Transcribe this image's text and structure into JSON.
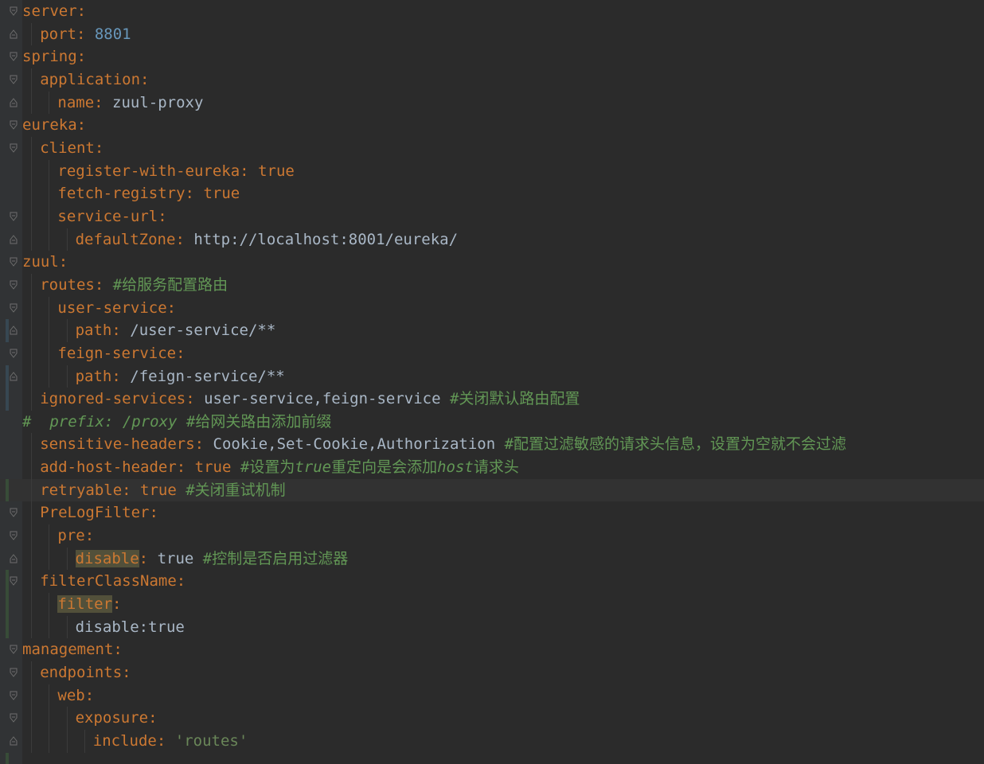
{
  "lines": [
    {
      "indent": 0,
      "fold": "open",
      "tokens": [
        {
          "t": "server",
          "c": "key"
        },
        {
          "t": ":",
          "c": "punc"
        }
      ]
    },
    {
      "indent": 1,
      "fold": "close",
      "tokens": [
        {
          "t": "port",
          "c": "key"
        },
        {
          "t": ": ",
          "c": "punc"
        },
        {
          "t": "8801",
          "c": "num"
        }
      ]
    },
    {
      "indent": 0,
      "fold": "open",
      "tokens": [
        {
          "t": "spring",
          "c": "key"
        },
        {
          "t": ":",
          "c": "punc"
        }
      ]
    },
    {
      "indent": 1,
      "fold": "open",
      "tokens": [
        {
          "t": "application",
          "c": "key"
        },
        {
          "t": ":",
          "c": "punc"
        }
      ]
    },
    {
      "indent": 2,
      "fold": "close",
      "tokens": [
        {
          "t": "name",
          "c": "key"
        },
        {
          "t": ": ",
          "c": "punc"
        },
        {
          "t": "zuul-proxy",
          "c": "val"
        }
      ]
    },
    {
      "indent": 0,
      "fold": "open",
      "tokens": [
        {
          "t": "eureka",
          "c": "key"
        },
        {
          "t": ":",
          "c": "punc"
        }
      ]
    },
    {
      "indent": 1,
      "fold": "open",
      "tokens": [
        {
          "t": "client",
          "c": "key"
        },
        {
          "t": ":",
          "c": "punc"
        }
      ]
    },
    {
      "indent": 2,
      "fold": "",
      "tokens": [
        {
          "t": "register-with-eureka",
          "c": "key"
        },
        {
          "t": ": ",
          "c": "punc"
        },
        {
          "t": "true",
          "c": "key"
        }
      ]
    },
    {
      "indent": 2,
      "fold": "",
      "tokens": [
        {
          "t": "fetch-registry",
          "c": "key"
        },
        {
          "t": ": ",
          "c": "punc"
        },
        {
          "t": "true",
          "c": "key"
        }
      ]
    },
    {
      "indent": 2,
      "fold": "open",
      "tokens": [
        {
          "t": "service-url",
          "c": "key"
        },
        {
          "t": ":",
          "c": "punc"
        }
      ]
    },
    {
      "indent": 3,
      "fold": "close",
      "tokens": [
        {
          "t": "defaultZone",
          "c": "key"
        },
        {
          "t": ": ",
          "c": "punc"
        },
        {
          "t": "http://localhost:8001/eureka/",
          "c": "val"
        }
      ]
    },
    {
      "indent": 0,
      "fold": "open",
      "tokens": [
        {
          "t": "zuul",
          "c": "key"
        },
        {
          "t": ":",
          "c": "punc"
        }
      ]
    },
    {
      "indent": 1,
      "fold": "open",
      "tokens": [
        {
          "t": "routes",
          "c": "key"
        },
        {
          "t": ": ",
          "c": "punc"
        },
        {
          "t": "#给服务配置路由",
          "c": "cmt"
        }
      ]
    },
    {
      "indent": 2,
      "fold": "open",
      "tokens": [
        {
          "t": "user-service",
          "c": "key"
        },
        {
          "t": ":",
          "c": "punc"
        }
      ]
    },
    {
      "indent": 3,
      "fold": "close",
      "change": "mod",
      "tokens": [
        {
          "t": "path",
          "c": "key"
        },
        {
          "t": ": ",
          "c": "punc"
        },
        {
          "t": "/user-service/**",
          "c": "val"
        }
      ]
    },
    {
      "indent": 2,
      "fold": "open",
      "tokens": [
        {
          "t": "feign-service",
          "c": "key"
        },
        {
          "t": ":",
          "c": "punc"
        }
      ]
    },
    {
      "indent": 3,
      "fold": "close",
      "change": "mod",
      "tokens": [
        {
          "t": "path",
          "c": "key"
        },
        {
          "t": ": ",
          "c": "punc"
        },
        {
          "t": "/feign-service/**",
          "c": "val"
        }
      ]
    },
    {
      "indent": 1,
      "fold": "",
      "change": "mod",
      "tokens": [
        {
          "t": "ignored-services",
          "c": "key"
        },
        {
          "t": ": ",
          "c": "punc"
        },
        {
          "t": "user-service,feign-service ",
          "c": "val"
        },
        {
          "t": "#关闭默认路由配置",
          "c": "cmt"
        }
      ]
    },
    {
      "indent": 0,
      "fold": "",
      "tokens": [
        {
          "t": "#  prefix: /proxy ",
          "c": "cmt cmt-it"
        },
        {
          "t": "#给网关路由添加前缀",
          "c": "cmt"
        }
      ]
    },
    {
      "indent": 1,
      "fold": "",
      "tokens": [
        {
          "t": "sensitive-headers",
          "c": "key"
        },
        {
          "t": ": ",
          "c": "punc"
        },
        {
          "t": "Cookie,Set-Cookie,Authorization ",
          "c": "val"
        },
        {
          "t": "#配置过滤敏感的请求头信息，设置为空就不会过滤",
          "c": "cmt"
        }
      ]
    },
    {
      "indent": 1,
      "fold": "",
      "tokens": [
        {
          "t": "add-host-header",
          "c": "key"
        },
        {
          "t": ": ",
          "c": "punc"
        },
        {
          "t": "true ",
          "c": "key"
        },
        {
          "t": "#设置为",
          "c": "cmt"
        },
        {
          "t": "true",
          "c": "cmt cmt-it"
        },
        {
          "t": "重定向是会添加",
          "c": "cmt"
        },
        {
          "t": "host",
          "c": "cmt cmt-it"
        },
        {
          "t": "请求头",
          "c": "cmt"
        }
      ]
    },
    {
      "indent": 1,
      "fold": "",
      "change": "add",
      "current": true,
      "tokens": [
        {
          "t": "retryable",
          "c": "key"
        },
        {
          "t": ": ",
          "c": "punc"
        },
        {
          "t": "true ",
          "c": "key"
        },
        {
          "t": "#关闭重试机制",
          "c": "cmt"
        }
      ]
    },
    {
      "indent": 1,
      "fold": "open",
      "tokens": [
        {
          "t": "PreLogFilter",
          "c": "key"
        },
        {
          "t": ":",
          "c": "punc"
        }
      ]
    },
    {
      "indent": 2,
      "fold": "open",
      "tokens": [
        {
          "t": "pre",
          "c": "key"
        },
        {
          "t": ":",
          "c": "punc"
        }
      ]
    },
    {
      "indent": 3,
      "fold": "close",
      "tokens": [
        {
          "t": "disable",
          "c": "key hl"
        },
        {
          "t": ": ",
          "c": "punc"
        },
        {
          "t": "true ",
          "c": "val"
        },
        {
          "t": "#控制是否启用过滤器",
          "c": "cmt"
        }
      ]
    },
    {
      "indent": 1,
      "fold": "open",
      "change": "add",
      "tokens": [
        {
          "t": "filterClassName",
          "c": "key"
        },
        {
          "t": ":",
          "c": "punc"
        }
      ]
    },
    {
      "indent": 2,
      "fold": "",
      "change": "add",
      "tokens": [
        {
          "t": "filter",
          "c": "key hl"
        },
        {
          "t": ":",
          "c": "punc"
        }
      ]
    },
    {
      "indent": 3,
      "fold": "",
      "change": "add",
      "tokens": [
        {
          "t": "disable:true",
          "c": "val"
        }
      ]
    },
    {
      "indent": 0,
      "fold": "open",
      "tokens": [
        {
          "t": "management",
          "c": "key"
        },
        {
          "t": ":",
          "c": "punc"
        }
      ]
    },
    {
      "indent": 1,
      "fold": "open",
      "tokens": [
        {
          "t": "endpoints",
          "c": "key"
        },
        {
          "t": ":",
          "c": "punc"
        }
      ]
    },
    {
      "indent": 2,
      "fold": "open",
      "tokens": [
        {
          "t": "web",
          "c": "key"
        },
        {
          "t": ":",
          "c": "punc"
        }
      ]
    },
    {
      "indent": 3,
      "fold": "open",
      "tokens": [
        {
          "t": "exposure",
          "c": "key"
        },
        {
          "t": ":",
          "c": "punc"
        }
      ]
    },
    {
      "indent": 4,
      "fold": "close",
      "tokens": [
        {
          "t": "include",
          "c": "key"
        },
        {
          "t": ": ",
          "c": "punc"
        },
        {
          "t": "'routes'",
          "c": "str"
        }
      ]
    },
    {
      "indent": 0,
      "fold": "",
      "change": "add",
      "tokens": []
    }
  ]
}
